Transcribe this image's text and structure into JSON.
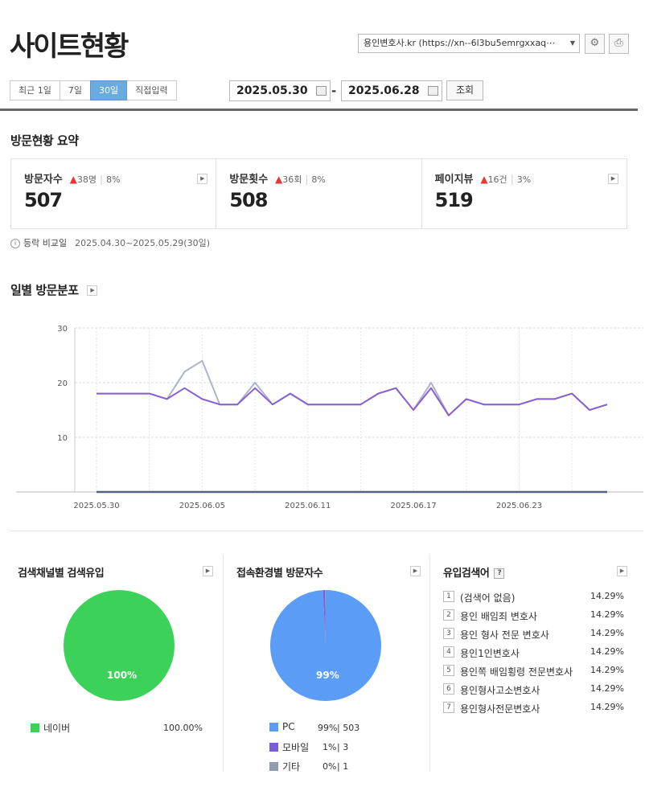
{
  "header": {
    "title": "사이트현황",
    "site_select": "용인변호사.kr (https://xn--6l3bu5emrgxxaq⋯",
    "settings_icon": "gear-icon",
    "print_icon": "printer-icon"
  },
  "range": {
    "periods": [
      "최근 1일",
      "7일",
      "30일",
      "직접입력"
    ],
    "active_period": "30일",
    "start_date": "2025.05.30",
    "end_date": "2025.06.28",
    "separator": "-",
    "search_label": "조회"
  },
  "summary": {
    "heading": "방문현황 요약",
    "stats": [
      {
        "label": "방문자수",
        "change": "38명",
        "pct": "8%",
        "value": "507"
      },
      {
        "label": "방문횟수",
        "change": "36회",
        "pct": "8%",
        "value": "508"
      },
      {
        "label": "페이지뷰",
        "change": "16건",
        "pct": "3%",
        "value": "519"
      }
    ],
    "compare_label": "등락 비교일",
    "compare_range": "2025.04.30~2025.05.29(30일)"
  },
  "daily": {
    "heading": "일별 방문분포"
  },
  "chart_data": {
    "type": "line",
    "x_ticks": [
      "2025.05.30",
      "2025.06.05",
      "2025.06.11",
      "2025.06.17",
      "2025.06.23"
    ],
    "x": [
      "05.30",
      "05.31",
      "06.01",
      "06.02",
      "06.03",
      "06.04",
      "06.05",
      "06.06",
      "06.07",
      "06.08",
      "06.09",
      "06.10",
      "06.11",
      "06.12",
      "06.13",
      "06.14",
      "06.15",
      "06.16",
      "06.17",
      "06.18",
      "06.19",
      "06.20",
      "06.21",
      "06.22",
      "06.23",
      "06.24",
      "06.25",
      "06.26",
      "06.27",
      "06.28"
    ],
    "series": [
      {
        "color": "#aeb4c6",
        "values": [
          18,
          18,
          18,
          18,
          17,
          22,
          24,
          16,
          16,
          20,
          16,
          18,
          16,
          16,
          16,
          16,
          18,
          19,
          15,
          20,
          14,
          17,
          16,
          16,
          16,
          17,
          17,
          18,
          15,
          16
        ]
      },
      {
        "color": "#8a5fd1",
        "values": [
          18,
          18,
          18,
          18,
          17,
          19,
          17,
          16,
          16,
          19,
          16,
          18,
          16,
          16,
          16,
          16,
          18,
          19,
          15,
          19,
          14,
          17,
          16,
          16,
          16,
          17,
          17,
          18,
          15,
          16
        ]
      },
      {
        "color": "#55617e",
        "values": [
          0,
          0,
          0,
          0,
          0,
          0,
          0,
          0,
          0,
          0,
          0,
          0,
          0,
          0,
          0,
          0,
          0,
          0,
          0,
          0,
          0,
          0,
          0,
          0,
          0,
          0,
          0,
          0,
          0,
          0
        ]
      }
    ],
    "y_ticks": [
      10,
      20,
      30
    ],
    "ylim": [
      0,
      30
    ],
    "grid": true
  },
  "channel": {
    "heading": "검색채널별 검색유입",
    "pie_label": "100%",
    "legend": [
      {
        "name": "네이버",
        "pct": "100.00%",
        "color": "#3cd25a",
        "value": 100
      }
    ]
  },
  "env": {
    "heading": "접속환경별 방문자수",
    "pie_label": "99%",
    "legend": [
      {
        "name": "PC",
        "pct": "99%",
        "count": "503",
        "color": "#5b9cf6",
        "value": 503
      },
      {
        "name": "모바일",
        "pct": "1%",
        "count": "3",
        "color": "#7b5ed6",
        "value": 3
      },
      {
        "name": "기타",
        "pct": "0%",
        "count": "1",
        "color": "#8f9bb0",
        "value": 1
      }
    ]
  },
  "keywords": {
    "heading": "유입검색어",
    "help": "?",
    "items": [
      {
        "rank": "1",
        "text": "(검색어 없음)",
        "pct": "14.29%"
      },
      {
        "rank": "2",
        "text": "용인 배임죄 변호사",
        "pct": "14.29%"
      },
      {
        "rank": "3",
        "text": "용인 형사 전문 변호사",
        "pct": "14.29%"
      },
      {
        "rank": "4",
        "text": "용인1인변호사",
        "pct": "14.29%"
      },
      {
        "rank": "5",
        "text": "용인쪽 배임횡령 전문변호사",
        "pct": "14.29%"
      },
      {
        "rank": "6",
        "text": "용인형사고소변호사",
        "pct": "14.29%"
      },
      {
        "rank": "7",
        "text": "용인형사전문변호사",
        "pct": "14.29%"
      }
    ]
  }
}
